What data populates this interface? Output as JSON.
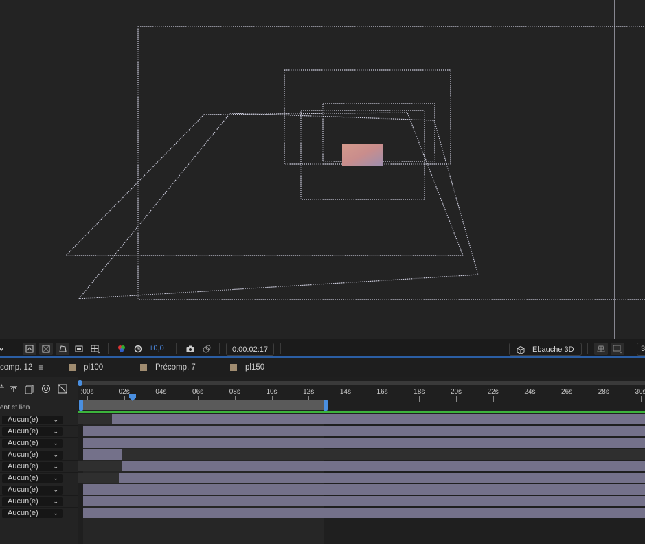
{
  "viewer_toolbar": {
    "exposure_value": "+0,0",
    "timecode": "0:00:02:17",
    "renderer_label": "Ebauche 3D",
    "truncated_right": "3"
  },
  "tabs": {
    "active_comp": "comp. 12",
    "items": [
      "pl100",
      "Précomp. 7",
      "pl150"
    ],
    "swatch_color": "#a08c70"
  },
  "timeline": {
    "column_header": "ent et lien",
    "ruler_labels": [
      ":00s",
      "02s",
      "04s",
      "06s",
      "08s",
      "10s",
      "12s",
      "14s",
      "16s",
      "18s",
      "20s",
      "22s",
      "24s",
      "26s",
      "28s",
      "30s"
    ],
    "layers": [
      {
        "parent": "Aucun(e)",
        "dark_until": 0.04
      },
      {
        "parent": "Aucun(e)",
        "dark_until": 0
      },
      {
        "parent": "Aucun(e)",
        "dark_until": 0
      },
      {
        "parent": "Aucun(e)",
        "light_until": 0.055
      },
      {
        "parent": "Aucun(e)",
        "dark_until": 0.055
      },
      {
        "parent": "Aucun(e)",
        "dark_until": 0.05
      },
      {
        "parent": "Aucun(e)",
        "dark_until": 0
      },
      {
        "parent": "Aucun(e)",
        "dark_until": 0
      },
      {
        "parent": "Aucun(e)",
        "dark_until": 0
      }
    ],
    "chevron": "⌄"
  },
  "colors": {
    "accent_blue": "#2b73d6",
    "layer_bar": "#74718a",
    "green_bar": "#3cb43c"
  }
}
